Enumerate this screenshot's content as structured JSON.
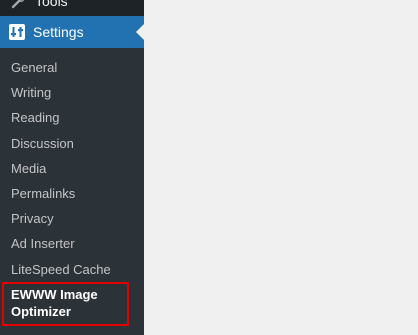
{
  "sidebar": {
    "tools_label": "Tools",
    "settings_label": "Settings",
    "submenu": [
      "General",
      "Writing",
      "Reading",
      "Discussion",
      "Media",
      "Permalinks",
      "Privacy",
      "Ad Inserter",
      "LiteSpeed Cache",
      "EWWW Image Optimizer"
    ]
  },
  "colors": {
    "sidebar_bg": "#1d2327",
    "submenu_bg": "#2c3338",
    "active_bg": "#2271b1",
    "highlight": "#e00000",
    "content_bg": "#f0f0f1"
  }
}
